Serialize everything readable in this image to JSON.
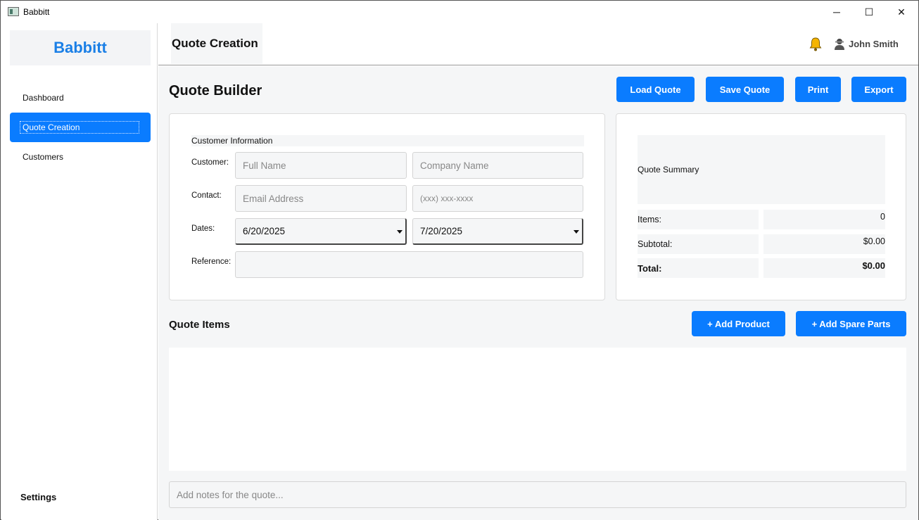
{
  "window": {
    "title": "Babbitt",
    "minimize_glyph": "─",
    "maximize_glyph": "☐",
    "close_glyph": "✕"
  },
  "sidebar": {
    "brand": "Babbitt",
    "items": [
      {
        "label": "Dashboard"
      },
      {
        "label": "Quote Creation",
        "active": true
      },
      {
        "label": "Customers"
      }
    ],
    "settings_label": "Settings"
  },
  "header": {
    "page_title": "Quote Creation",
    "user_name": "John Smith",
    "icons": [
      "bell-icon",
      "user-icon"
    ],
    "bell_color": "#f5b400"
  },
  "main": {
    "heading": "Quote Builder",
    "buttons": {
      "load": "Load Quote",
      "save": "Save Quote",
      "print": "Print",
      "export": "Export"
    },
    "accent_color": "#0a7cff",
    "customer_info": {
      "section_label": "Customer Information",
      "customer_label": "Customer:",
      "full_name_placeholder": "Full Name",
      "company_placeholder": "Company Name",
      "contact_label": "Contact:",
      "email_placeholder": "Email Address",
      "phone_placeholder": "(xxx) xxx-xxxx",
      "dates_label": "Dates:",
      "date_start": "6/20/2025",
      "date_end": "7/20/2025",
      "reference_label": "Reference:",
      "reference_value": ""
    },
    "summary": {
      "heading": "Quote Summary",
      "items_label": "Items:",
      "items_value": "0",
      "subtotal_label": "Subtotal:",
      "subtotal_value": "$0.00",
      "total_label": "Total:",
      "total_value": "$0.00"
    },
    "quote_items": {
      "heading": "Quote Items",
      "add_product": "+ Add Product",
      "add_spare_parts": "+ Add Spare Parts"
    },
    "notes_placeholder": "Add notes for the quote..."
  }
}
